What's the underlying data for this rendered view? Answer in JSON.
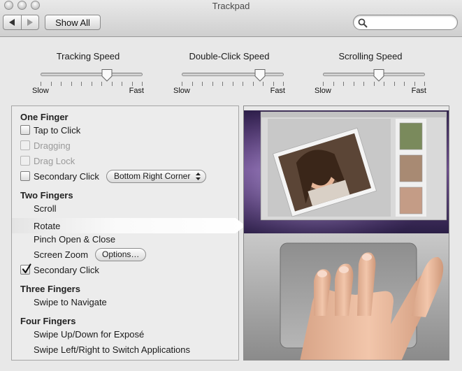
{
  "window": {
    "title": "Trackpad"
  },
  "toolbar": {
    "show_all_label": "Show All",
    "search_placeholder": ""
  },
  "sliders": [
    {
      "title": "Tracking Speed",
      "min_label": "Slow",
      "max_label": "Fast",
      "value_fraction": 0.65
    },
    {
      "title": "Double-Click Speed",
      "min_label": "Slow",
      "max_label": "Fast",
      "value_fraction": 0.77
    },
    {
      "title": "Scrolling Speed",
      "min_label": "Slow",
      "max_label": "Fast",
      "value_fraction": 0.55
    }
  ],
  "sections": {
    "one_finger": {
      "title": "One Finger",
      "tap_to_click": {
        "label": "Tap to Click",
        "checked": false,
        "enabled": true
      },
      "dragging": {
        "label": "Dragging",
        "checked": false,
        "enabled": false
      },
      "drag_lock": {
        "label": "Drag Lock",
        "checked": false,
        "enabled": false
      },
      "secondary_click": {
        "label": "Secondary Click",
        "checked": false,
        "enabled": true,
        "popup_value": "Bottom Right Corner"
      }
    },
    "two_fingers": {
      "title": "Two Fingers",
      "scroll": "Scroll",
      "rotate": "Rotate",
      "pinch": "Pinch Open & Close",
      "screen_zoom": "Screen Zoom",
      "options_button": "Options…",
      "secondary_click": {
        "label": "Secondary Click",
        "checked": true,
        "enabled": true
      }
    },
    "three_fingers": {
      "title": "Three Fingers",
      "swipe": "Swipe to Navigate"
    },
    "four_fingers": {
      "title": "Four Fingers",
      "swipe_up_down": "Swipe Up/Down for Exposé",
      "swipe_left_right": "Swipe Left/Right to Switch Applications"
    }
  },
  "selected_gesture": "rotate",
  "colors": {
    "selection_highlight": "#ffffff",
    "desktop_purple": "#5a3f7a",
    "trackpad_silver": "#a7a7a7"
  }
}
